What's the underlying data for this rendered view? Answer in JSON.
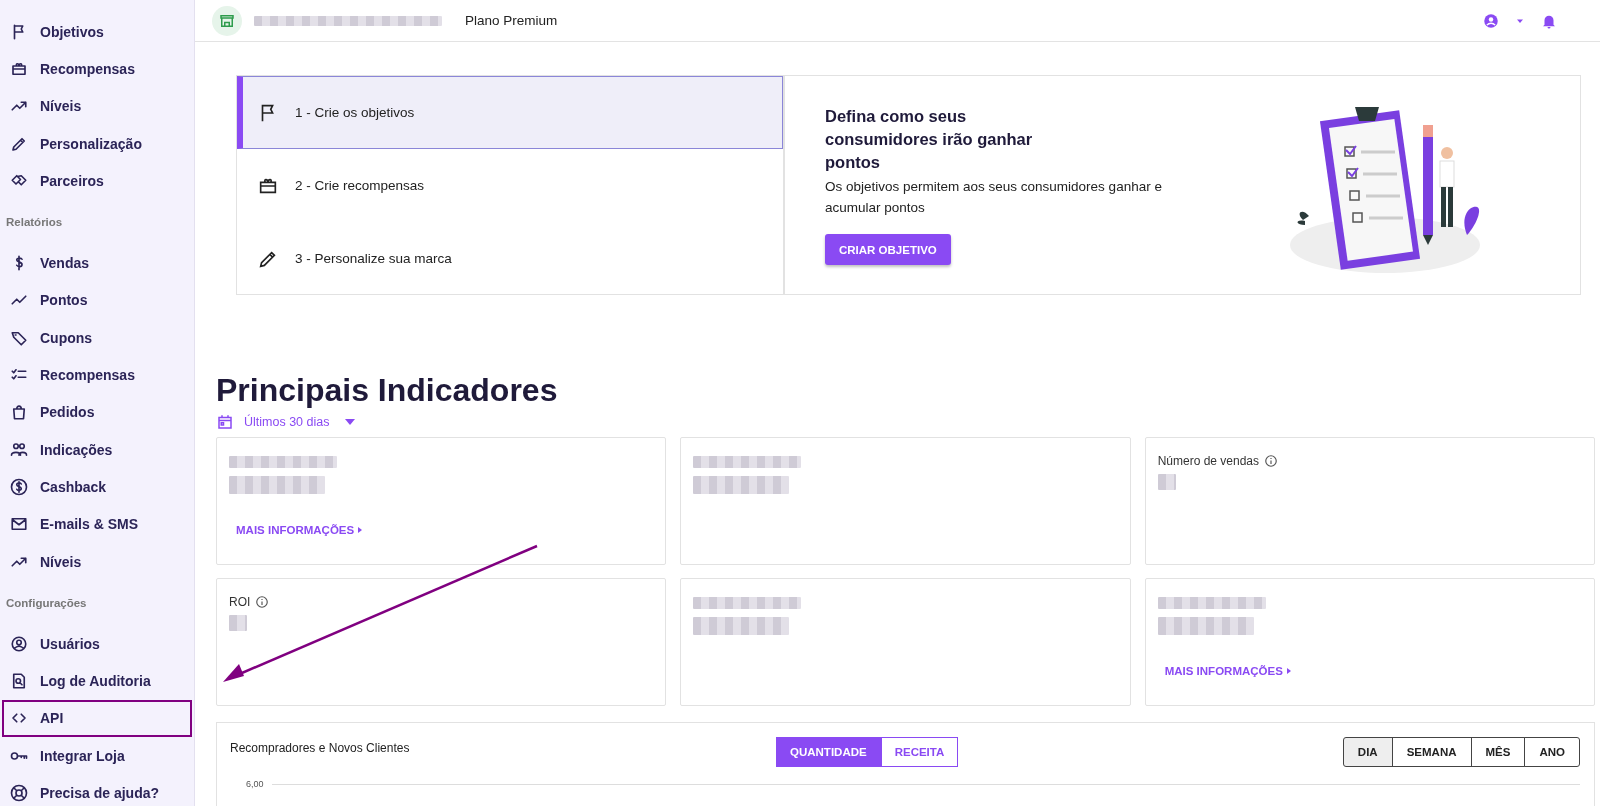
{
  "sidebar": {
    "sections": [
      {
        "items": [
          {
            "label": "Objetivos",
            "highlighted": false
          },
          {
            "label": "Recompensas",
            "highlighted": false
          },
          {
            "label": "Níveis",
            "highlighted": false
          },
          {
            "label": "Personalização",
            "highlighted": false
          },
          {
            "label": "Parceiros",
            "highlighted": false
          }
        ]
      },
      {
        "title": "Relatórios",
        "items": [
          {
            "label": "Vendas",
            "highlighted": false
          },
          {
            "label": "Pontos",
            "highlighted": false
          },
          {
            "label": "Cupons",
            "highlighted": false
          },
          {
            "label": "Recompensas",
            "highlighted": false
          },
          {
            "label": "Pedidos",
            "highlighted": false
          },
          {
            "label": "Indicações",
            "highlighted": false
          },
          {
            "label": "Cashback",
            "highlighted": false
          },
          {
            "label": "E-mails & SMS",
            "highlighted": false
          },
          {
            "label": "Níveis",
            "highlighted": false
          }
        ]
      },
      {
        "title": "Configurações",
        "items": [
          {
            "label": "Usuários",
            "highlighted": false
          },
          {
            "label": "Log de Auditoria",
            "highlighted": false
          },
          {
            "label": "API",
            "highlighted": true
          },
          {
            "label": "Integrar Loja",
            "highlighted": false
          },
          {
            "label": "Precisa de ajuda?",
            "highlighted": false
          }
        ]
      }
    ]
  },
  "header": {
    "plan": "Plano Premium"
  },
  "onboarding": {
    "steps": [
      {
        "label": "1 - Crie os objetivos",
        "selected": true
      },
      {
        "label": "2 - Crie recompensas",
        "selected": false
      },
      {
        "label": "3 - Personalize sua marca",
        "selected": false
      }
    ],
    "panel": {
      "title": "Defina como seus consumidores irão ganhar pontos",
      "description": "Os objetivos permitem aos seus consumidores ganhar e acumular pontos",
      "button": "CRIAR OBJETIVO"
    }
  },
  "indicators": {
    "title": "Principais Indicadores",
    "period": "Últimos 30 dias",
    "cards": [
      {
        "kind": "masked",
        "link": "MAIS INFORMAÇÕES"
      },
      {
        "kind": "masked"
      },
      {
        "kind": "labeled",
        "label": "Número de vendas"
      },
      {
        "kind": "labeled",
        "label": "ROI"
      },
      {
        "kind": "masked"
      },
      {
        "kind": "masked",
        "link": "MAIS INFORMAÇÕES"
      }
    ]
  },
  "chart": {
    "title": "Recompradores e Novos Clientes",
    "measures": [
      {
        "label": "QUANTIDADE",
        "selected": true
      },
      {
        "label": "RECEITA",
        "selected": false
      }
    ],
    "periods": [
      {
        "label": "DIA",
        "selected": true
      },
      {
        "label": "SEMANA",
        "selected": false
      },
      {
        "label": "MÊS",
        "selected": false
      },
      {
        "label": "ANO",
        "selected": false
      }
    ],
    "y_tick": "6,00"
  }
}
